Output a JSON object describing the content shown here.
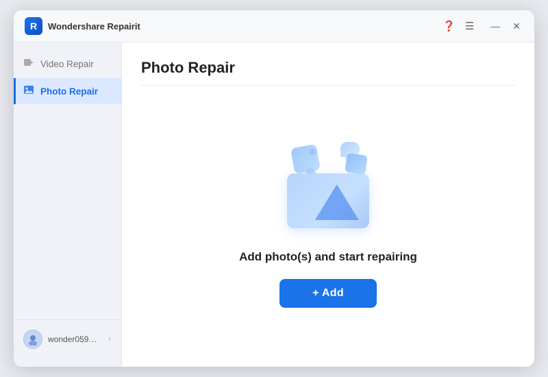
{
  "app": {
    "title": "Wondershare Repairit",
    "logo_text": "R"
  },
  "titlebar": {
    "help_icon": "❓",
    "menu_icon": "☰",
    "minimize_icon": "—",
    "close_icon": "✕"
  },
  "sidebar": {
    "items": [
      {
        "id": "video-repair",
        "label": "Video Repair",
        "icon": "🎬",
        "active": false
      },
      {
        "id": "photo-repair",
        "label": "Photo Repair",
        "icon": "🖼",
        "active": true
      }
    ],
    "user": {
      "name": "wonder059@16...",
      "avatar_icon": "👤",
      "chevron": "›"
    }
  },
  "main": {
    "page_title": "Photo Repair",
    "body_text": "Add photo(s) and start repairing",
    "add_button_label": "+ Add"
  }
}
